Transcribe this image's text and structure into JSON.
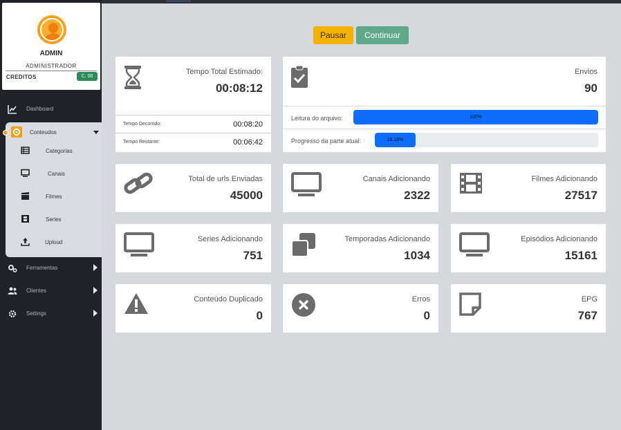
{
  "profile": {
    "name": "ADMIN",
    "role": "ADMINISTRADOR",
    "credits_label": "CREDITOS",
    "credits_value": "C. 00"
  },
  "sidebar": {
    "dashboard": "Dashboard",
    "conteudos": "Conteudos",
    "submenu": [
      "Categorias",
      "Canais",
      "Filmes",
      "Series",
      "Uploud"
    ],
    "ferramentas": "Ferramentas",
    "clientes": "Clientes",
    "settings": "Settings"
  },
  "buttons": {
    "pause": "Pausar",
    "continue": "Continuar"
  },
  "time": {
    "title": "Tempo Total Estimado:",
    "value": "00:08:12",
    "elapsed_label": "Tempo Decorrido:",
    "elapsed_value": "00:08:20",
    "remaining_label": "Tempo Restante:",
    "remaining_value": "00:06:42"
  },
  "envios": {
    "title": "Envios",
    "value": "90",
    "file_read_label": "Leitura do arquivo:",
    "file_read_text": "100%",
    "file_read_fraction": 1.0,
    "current_label": "Progresso da parte atual:",
    "current_text": "18.18%",
    "current_fraction": 0.1818
  },
  "stats": [
    {
      "title": "Total de urls Enviadas",
      "value": "45000",
      "icon": "link-icon"
    },
    {
      "title": "Canais Adicionando",
      "value": "2322",
      "icon": "monitor-icon"
    },
    {
      "title": "Filmes Adicionando",
      "value": "27517",
      "icon": "film-icon"
    },
    {
      "title": "Series Adicionando",
      "value": "751",
      "icon": "monitor-icon"
    },
    {
      "title": "Temporadas Adicionando",
      "value": "1034",
      "icon": "copy-icon"
    },
    {
      "title": "Episódios Adicionando",
      "value": "15161",
      "icon": "monitor-icon"
    },
    {
      "title": "Conteúdo Duplicado",
      "value": "0",
      "icon": "warning-icon"
    },
    {
      "title": "Erros",
      "value": "0",
      "icon": "close-circle-icon"
    },
    {
      "title": "EPG",
      "value": "767",
      "icon": "note-icon"
    }
  ],
  "colors": {
    "sidebar": "#1f2229",
    "accent": "#f59e0b",
    "progress": "#0d6efd",
    "pause": "#f5b301",
    "continue": "#5fa98a"
  }
}
